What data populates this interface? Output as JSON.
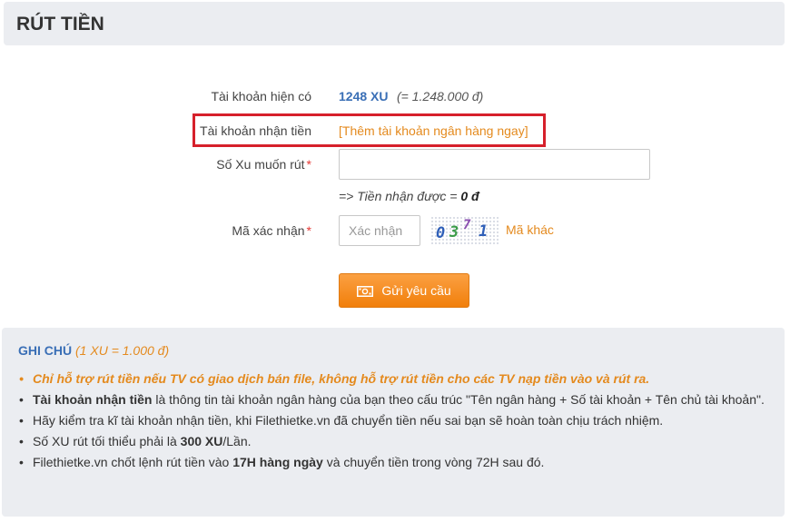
{
  "title": "RÚT TIỀN",
  "form": {
    "balance_label": "Tài khoản hiện có",
    "balance_xu": "1248 XU",
    "balance_vnd": "(= 1.248.000 đ)",
    "receive_account_label": "Tài khoản nhận tiền",
    "add_bank_link": "[Thêm tài khoản ngân hàng ngay]",
    "xu_amount_label": "Số Xu muốn rút",
    "xu_amount_value": "",
    "required_mark": "*",
    "receive_prefix": "=> Tiền nhận được = ",
    "receive_amount": "0 đ",
    "captcha_label": "Mã xác nhận",
    "captcha_placeholder": "Xác nhận",
    "captcha_chars": [
      "0",
      "3",
      "7",
      "1"
    ],
    "captcha_refresh": "Mã khác",
    "submit_label": "Gửi yêu cầu"
  },
  "notes": {
    "title": "GHI CHÚ",
    "subtitle": "(1 XU = 1.000 đ)",
    "warning": "Chỉ hỗ trợ rút tiền nếu TV có giao dịch bán file, không hỗ trợ rút tiền cho các TV nạp tiền vào và rút ra.",
    "item2_bold": "Tài khoản nhận tiền",
    "item2_text": " là thông tin tài khoản ngân hàng của bạn theo cấu trúc \"Tên ngân hàng + Số tài khoản + Tên chủ tài khoản\".",
    "item3": "Hãy kiểm tra kĩ tài khoản nhận tiền, khi Filethietke.vn đã chuyển tiền nếu sai bạn sẽ hoàn toàn chịu trách nhiệm.",
    "item4_pre": "Số XU rút tối thiểu phải là ",
    "item4_bold": "300 XU",
    "item4_post": "/Lần.",
    "item5_pre": "Filethietke.vn chốt lệnh rút tiền vào ",
    "item5_bold": "17H hàng ngày",
    "item5_post": " và chuyển tiền trong vòng 72H sau đó."
  },
  "colors": {
    "accent_blue": "#3a6fb6",
    "accent_orange": "#e48a1e",
    "highlight_red": "#d6202b",
    "button_orange": "#f39019"
  },
  "icons": {
    "submit": "cash-icon"
  }
}
